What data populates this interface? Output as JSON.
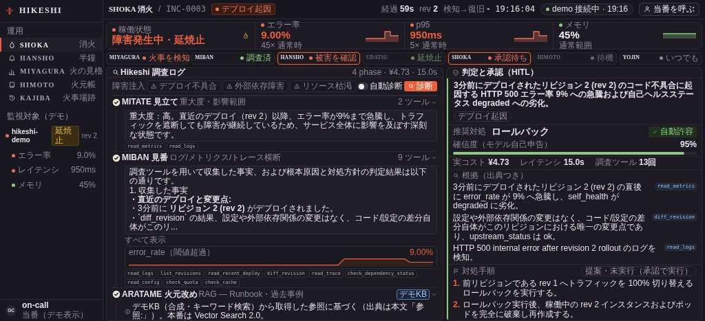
{
  "brand": {
    "name": "HIKESHI"
  },
  "sidebar": {
    "sections": [
      {
        "label": "運用",
        "items": [
          {
            "label": "SHOKA",
            "sub": "消火",
            "selected": true
          },
          {
            "label": "HANSHO",
            "sub": "半鐘",
            "selected": false
          },
          {
            "label": "MIYAGURA",
            "sub": "火の見櫓",
            "selected": false
          },
          {
            "label": "HIMOTO",
            "sub": "火元帳",
            "selected": false
          },
          {
            "label": "KAJIBA",
            "sub": "火事場跡",
            "selected": false
          }
        ]
      }
    ],
    "monitor": {
      "label": "監視対象（デモ）",
      "service": {
        "name": "hikeshi-demo",
        "status": "延焼止",
        "revision": "rev 2",
        "color": "#e8705a"
      },
      "metrics": [
        {
          "label": "エラー率",
          "value": "9.0%",
          "color": "#e8705a"
        },
        {
          "label": "レイテンシ",
          "value": "950ms",
          "color": "#e8705a"
        },
        {
          "label": "メモリ",
          "value": "45%",
          "color": "#8cc97e"
        }
      ]
    },
    "user": {
      "initials": "OC",
      "role": "on-call",
      "name": "当番（デモ表示）"
    }
  },
  "header": {
    "title": "SHOKA 消火",
    "separator": "/",
    "incident": "INC-0003",
    "cause_badge": "デプロイ起因",
    "stats": [
      {
        "label": "経過",
        "value": "59s"
      },
      {
        "label": "rev",
        "value": "2"
      },
      {
        "label": "検知→復旧",
        "value": "-"
      }
    ],
    "clock": "19:16:04",
    "connection": "demo 接続中 · 19:16",
    "call_button": "当番を呼ぶ"
  },
  "stat_cards": [
    {
      "kind": "status",
      "label": "稼働状態",
      "value": "障害発生中・延焼止",
      "color": "#e8705a",
      "alert": true
    },
    {
      "kind": "spike",
      "label": "エラー率",
      "value": "9.00%",
      "note": "45× 通常時",
      "color": "#e8705a",
      "alert": true
    },
    {
      "kind": "spike",
      "label": "p95",
      "value": "950ms",
      "note": "5× 通常時",
      "color": "#e8705a",
      "alert": true
    },
    {
      "kind": "flat",
      "label": "メモリ",
      "value": "45%",
      "note": "通常範囲",
      "color": "#8cc97e",
      "alert": false
    }
  ],
  "phases": [
    {
      "name": "MIYAGURA",
      "status": "火事を検知",
      "color": "#e8705a",
      "highlighted": false,
      "dimmed": false
    },
    {
      "name": "MIBAN",
      "status": "調査済",
      "color": "#8cc97e",
      "highlighted": false,
      "dimmed": false
    },
    {
      "name": "HANSHO",
      "status": "被害を確認",
      "color": "#e8705a",
      "highlighted": true,
      "dimmed": false
    },
    {
      "name": "UDATSU",
      "status": "延焼止",
      "color": "#6f8a6a",
      "highlighted": false,
      "dimmed": true
    },
    {
      "name": "SHOKA",
      "status": "承認待ち",
      "color": "#e8705a",
      "highlighted": true,
      "dimmed": false
    },
    {
      "name": "HIMOTO",
      "status": "待機",
      "color": "#6b6872",
      "highlighted": false,
      "dimmed": true
    },
    {
      "name": "YOJIN",
      "status": "いつでも",
      "color": "#8a8790",
      "highlighted": false,
      "dimmed": false
    }
  ],
  "log": {
    "title": "Hikeshi 調査ログ",
    "summary": "4 phase · ¥4.73 · 15.0s",
    "inject": {
      "label": "障害注入",
      "options": [
        "デプロイ不具合",
        "外部依存障害",
        "リソース枯渇"
      ],
      "auto": {
        "label": "自動診断",
        "on": false
      },
      "run_button": "診断"
    },
    "steps": [
      {
        "name": "MITATE 見立て",
        "subtitle": "重大度・影響範囲",
        "count": "2 ツール",
        "done": true,
        "body": [
          "重大度：高。直近のデプロイ（rev 2）以降、エラー率が9%まで急騰し、トラフィックを遮断しても障害が継続しているため、サービス全体に影響を及ぼす深刻な状態です。"
        ],
        "tools": [
          "read_metrics",
          "read_logs"
        ]
      },
      {
        "name": "MIBAN 見番",
        "subtitle": "ログ/メトリクス/トレース横断",
        "count": "9 ツール",
        "done": true,
        "body": [
          "調査ツールを用いて収集した事実、および根本原因と対処方針の判定結果は以下の通りです。",
          "1. 収集した事実",
          "**・直近のデプロイと変更点:**",
          "・3分前に **リビジョン 2 (rev 2)** がデプロイされました。",
          "・`diff_revision` の結果、設定や外部依存関係の変更はなく、コード/設定の差分自体がこのリ..."
        ],
        "show_all": "すべて表示",
        "chart": {
          "label": "error_rate（閾値超過）",
          "reading": "9.00%"
        },
        "tools": [
          "read_logs",
          "list_revisions",
          "read_recent_deploy",
          "diff_revision",
          "read_trace",
          "check_dependency_status",
          "read_config",
          "check_quota",
          "check_cache"
        ]
      },
      {
        "name": "ARATAME 火元改め",
        "subtitle": "RAG — Runbook・過去事例",
        "badge": "デモKB",
        "done": true,
        "note": "デモKB（合成・キーワード検索）から取得した参照に基づく（出典は本文「参照:」）。本番は Vector Search 2.0。"
      }
    ]
  },
  "verdict": {
    "title": "判定と承認（HITL）",
    "summary": "3分前にデプロイされたリビジョン 2 (rev 2) のコード不具合に起因する HTTP 500 エラー率 9% への急騰および自己ヘルスステータス degraded への劣化。",
    "tag": "デプロイ起因",
    "recommend_label": "推奨対処",
    "action": "ロールバック",
    "auto_badge": "自動許容",
    "confidence": {
      "label": "確信度（モデル自己申告）",
      "reading": "95%",
      "level": 0.95
    },
    "metrics": [
      {
        "label": "実コスト",
        "value": "¥4.73"
      },
      {
        "label": "レイテンシ",
        "value": "15.0s"
      },
      {
        "label": "調査ツール",
        "value": "13回"
      }
    ],
    "evidence": {
      "title": "根拠（出典つき）",
      "items": [
        {
          "text": "3分前にデプロイされたリビジョン 2 (rev 2) の直後に error_rate が 9% へ急騰し、self_health が degraded に劣化。",
          "source": "read_metrics"
        },
        {
          "text": "設定や外部依存関係の変更はなく、コード/設定の差分自体がこのリビジョンにおける唯一の変更点であり、upstream_status は ok。",
          "source": "diff_revision"
        },
        {
          "text": "HTTP 500 internal error after revision 2 rollout のログを検知。",
          "source": "read_logs"
        }
      ]
    },
    "plan": {
      "title": "対処手順",
      "status": "提案・未実行（承認で実行）",
      "steps": [
        {
          "number": "1.",
          "text": "前リビジョンである rev 1 へトラフィックを 100% 切り替えるロールバックを実行する。"
        },
        {
          "number": "2.",
          "text": "ロールバック実行後、稼働中の rev 2 インスタンスおよびポッドを完全に破棄し再作成する。"
        }
      ]
    }
  }
}
